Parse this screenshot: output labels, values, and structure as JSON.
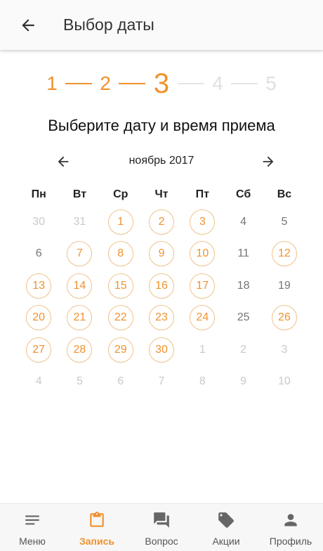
{
  "header": {
    "title": "Выбор даты"
  },
  "stepper": {
    "current": 3,
    "steps": [
      "1",
      "2",
      "3",
      "4",
      "5"
    ]
  },
  "heading": "Выберите дату и время приема",
  "calendar": {
    "month_label": "ноябрь 2017",
    "weekdays": [
      "Пн",
      "Вт",
      "Ср",
      "Чт",
      "Пт",
      "Сб",
      "Вс"
    ],
    "days": [
      {
        "label": "30",
        "state": "other"
      },
      {
        "label": "31",
        "state": "other"
      },
      {
        "label": "1",
        "state": "available"
      },
      {
        "label": "2",
        "state": "available"
      },
      {
        "label": "3",
        "state": "available"
      },
      {
        "label": "4",
        "state": "unavailable"
      },
      {
        "label": "5",
        "state": "unavailable"
      },
      {
        "label": "6",
        "state": "unavailable"
      },
      {
        "label": "7",
        "state": "available"
      },
      {
        "label": "8",
        "state": "available"
      },
      {
        "label": "9",
        "state": "available"
      },
      {
        "label": "10",
        "state": "available"
      },
      {
        "label": "11",
        "state": "unavailable"
      },
      {
        "label": "12",
        "state": "available"
      },
      {
        "label": "13",
        "state": "available"
      },
      {
        "label": "14",
        "state": "available"
      },
      {
        "label": "15",
        "state": "available"
      },
      {
        "label": "16",
        "state": "available"
      },
      {
        "label": "17",
        "state": "available"
      },
      {
        "label": "18",
        "state": "unavailable"
      },
      {
        "label": "19",
        "state": "unavailable"
      },
      {
        "label": "20",
        "state": "available"
      },
      {
        "label": "21",
        "state": "available"
      },
      {
        "label": "22",
        "state": "available"
      },
      {
        "label": "23",
        "state": "available"
      },
      {
        "label": "24",
        "state": "available"
      },
      {
        "label": "25",
        "state": "unavailable"
      },
      {
        "label": "26",
        "state": "available"
      },
      {
        "label": "27",
        "state": "available"
      },
      {
        "label": "28",
        "state": "available"
      },
      {
        "label": "29",
        "state": "available"
      },
      {
        "label": "30",
        "state": "available"
      },
      {
        "label": "1",
        "state": "other"
      },
      {
        "label": "2",
        "state": "other"
      },
      {
        "label": "3",
        "state": "other"
      },
      {
        "label": "4",
        "state": "other"
      },
      {
        "label": "5",
        "state": "other"
      },
      {
        "label": "6",
        "state": "other"
      },
      {
        "label": "7",
        "state": "other"
      },
      {
        "label": "8",
        "state": "other"
      },
      {
        "label": "9",
        "state": "other"
      },
      {
        "label": "10",
        "state": "other"
      }
    ]
  },
  "bottom_nav": {
    "items": [
      {
        "label": "Меню",
        "icon": "menu-icon",
        "active": false
      },
      {
        "label": "Запись",
        "icon": "clipboard-icon",
        "active": true
      },
      {
        "label": "Вопрос",
        "icon": "chat-icon",
        "active": false
      },
      {
        "label": "Акции",
        "icon": "tag-icon",
        "active": false
      },
      {
        "label": "Профиль",
        "icon": "person-icon",
        "active": false
      }
    ]
  },
  "colors": {
    "accent": "#f0922e",
    "accent_border": "#f0c28c",
    "inactive_step": "#e0e0e0",
    "other_month_day": "#c9c9c9",
    "unavailable_day": "#757575"
  }
}
